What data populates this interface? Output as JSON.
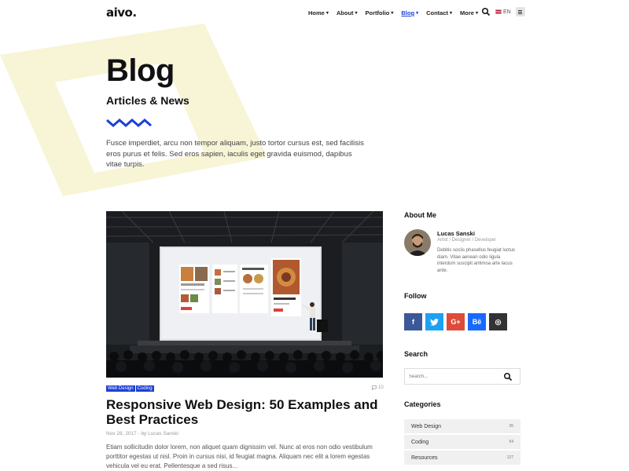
{
  "header": {
    "logo": "aivo.",
    "nav": [
      {
        "label": "Home",
        "active": false
      },
      {
        "label": "About",
        "active": false
      },
      {
        "label": "Portfolio",
        "active": false
      },
      {
        "label": "Blog",
        "active": true
      },
      {
        "label": "Contact",
        "active": false
      },
      {
        "label": "More",
        "active": false
      }
    ],
    "language": "EN"
  },
  "hero": {
    "title": "Blog",
    "subtitle": "Articles & News",
    "description": "Fusce imperdiet, arcu non tempor aliquam, justo tortor cursus est, sed facilisis eros purus et felis. Sed eros sapien, iaculis eget gravida euismod, dapibus vitae turpis."
  },
  "post": {
    "tags": [
      "Web Design",
      "Coding"
    ],
    "comments": "10",
    "title": "Responsive Web Design: 50 Examples and Best Practices",
    "meta": "Nov 28, 2017 - by Lucas Sanski",
    "excerpt": "Etiam sollicitudin dolor lorem, non aliquet quam dignissim vel. Nunc at eros non odio vestibulum porttitor egestas ut nisl. Proin in cursus nisi, id feugiat magna. Aliquam nec elit a lorem egestas vehicula vel eu erat. Pellentesque a sed risus..."
  },
  "sidebar": {
    "about": {
      "heading": "About Me",
      "name": "Lucas Sanski",
      "role": "Artist / Designer / Developer",
      "bio": "Debitis sociis phasellus feugiat luctus diam. Vitae aenean odio ligula interdum suscipit antimoa arte lacus ante."
    },
    "follow": {
      "heading": "Follow",
      "networks": [
        {
          "icon": "facebook-icon",
          "glyph": "f",
          "color": "#3b5998"
        },
        {
          "icon": "twitter-icon",
          "glyph": "t",
          "color": "#1da1f2"
        },
        {
          "icon": "google-plus-icon",
          "glyph": "G+",
          "color": "#dd4b39"
        },
        {
          "icon": "behance-icon",
          "glyph": "Bē",
          "color": "#1769ff"
        },
        {
          "icon": "dribbble-icon",
          "glyph": "◎",
          "color": "#333333"
        }
      ]
    },
    "search": {
      "heading": "Search",
      "placeholder": "Search..."
    },
    "categories": {
      "heading": "Categories",
      "items": [
        {
          "name": "Web Design",
          "count": "26"
        },
        {
          "name": "Coding",
          "count": "54"
        },
        {
          "name": "Resources",
          "count": "127"
        }
      ]
    }
  },
  "colors": {
    "accent": "#1b3fd6",
    "shape": "#f7f5d6"
  }
}
